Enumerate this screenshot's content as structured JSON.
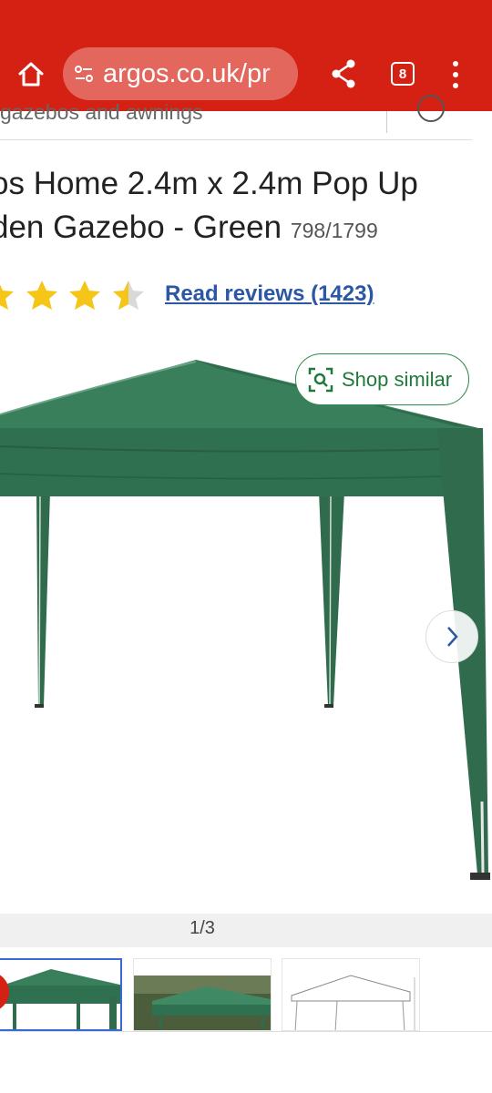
{
  "browser": {
    "url": "argos.co.uk/pr",
    "tab_count": "8",
    "home_icon": "home-icon",
    "site_settings_icon": "tune-icon",
    "share_icon": "share-icon",
    "menu_icon": "more-vertical-icon"
  },
  "breadcrumb": {
    "text": "gazebos and awnings"
  },
  "product": {
    "title_line1": "os Home 2.4m x 2.4m Pop Up",
    "title_line2": "den Gazebo - Green",
    "price_code": "798/1799",
    "rating": 4.5,
    "rating_max": 5,
    "reviews_label": "Read reviews (1423)"
  },
  "gallery": {
    "shop_similar_label": "Shop similar",
    "counter": "1/3",
    "next_icon": "chevron-right-icon"
  },
  "colors": {
    "browser_red": "#d42114",
    "link_blue": "#2b57a5",
    "green_accent": "#1f7a3a",
    "star_yellow": "#f5c518",
    "gazebo_green": "#2e6e4f"
  }
}
